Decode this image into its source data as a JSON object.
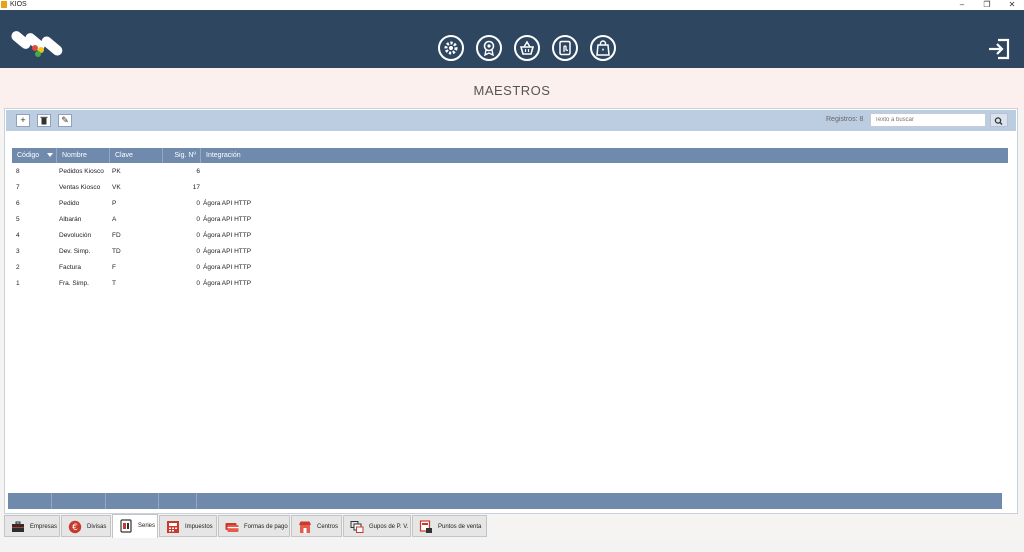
{
  "window": {
    "title": "KIOS",
    "minimize": "–",
    "maximize": "❐",
    "close": "✕"
  },
  "colors": {
    "topbar": "#2e4660",
    "accent": "#6f8aad",
    "toolbar": "#bccde2"
  },
  "nav": {
    "icons": [
      "gear-icon",
      "badge-icon",
      "basket-icon",
      "touch-document-icon",
      "shopping-bag-icon"
    ],
    "exit_icon": "exit-icon"
  },
  "page": {
    "title": "MAESTROS"
  },
  "toolbar": {
    "add_label": "+",
    "delete_label": "🗑",
    "edit_label": "✎",
    "records_label": "Registros: 8",
    "search_placeholder": "Texto a buscar"
  },
  "table": {
    "columns": [
      "Código",
      "Nombre",
      "Clave",
      "Sig. Nº",
      "Integración"
    ],
    "rows": [
      {
        "codigo": "8",
        "nombre": "Pedidos Kiosco",
        "clave": "PK",
        "sig": "6",
        "integracion": ""
      },
      {
        "codigo": "7",
        "nombre": "Ventas Kiosco",
        "clave": "VK",
        "sig": "17",
        "integracion": ""
      },
      {
        "codigo": "6",
        "nombre": "Pedido",
        "clave": "P",
        "sig": "0",
        "integracion": "Ágora API HTTP"
      },
      {
        "codigo": "5",
        "nombre": "Albarán",
        "clave": "A",
        "sig": "0",
        "integracion": "Ágora API HTTP"
      },
      {
        "codigo": "4",
        "nombre": "Devolución",
        "clave": "FD",
        "sig": "0",
        "integracion": "Ágora API HTTP"
      },
      {
        "codigo": "3",
        "nombre": "Dev. Simp.",
        "clave": "TD",
        "sig": "0",
        "integracion": "Ágora API HTTP"
      },
      {
        "codigo": "2",
        "nombre": "Factura",
        "clave": "F",
        "sig": "0",
        "integracion": "Ágora API HTTP"
      },
      {
        "codigo": "1",
        "nombre": "Fra. Simp.",
        "clave": "T",
        "sig": "0",
        "integracion": "Ágora API HTTP"
      }
    ]
  },
  "tabs": [
    {
      "label": "Empresas",
      "icon": "briefcase-icon",
      "active": false
    },
    {
      "label": "Divisas",
      "icon": "euro-icon",
      "active": false
    },
    {
      "label": "Series",
      "icon": "series-icon",
      "active": true
    },
    {
      "label": "Impuestos",
      "icon": "tax-icon",
      "active": false
    },
    {
      "label": "Formas de pago",
      "icon": "card-icon",
      "active": false
    },
    {
      "label": "Centros",
      "icon": "store-icon",
      "active": false
    },
    {
      "label": "Gupos de P. V.",
      "icon": "pos-group-icon",
      "active": false
    },
    {
      "label": "Puntos de venta",
      "icon": "pos-icon",
      "active": false
    }
  ]
}
